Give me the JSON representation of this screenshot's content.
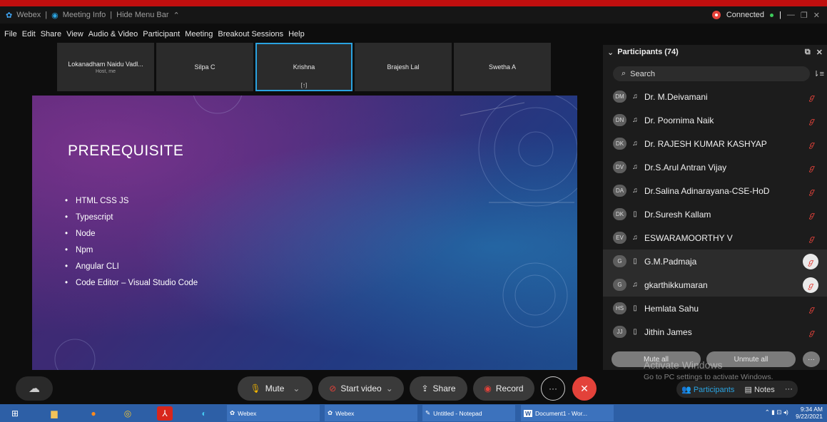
{
  "titlebar": {
    "app": "Webex",
    "info": "Meeting Info",
    "hide": "Hide Menu Bar",
    "status": "Connected"
  },
  "menu": [
    "File",
    "Edit",
    "Share",
    "View",
    "Audio & Video",
    "Participant",
    "Meeting",
    "Breakout Sessions",
    "Help"
  ],
  "thumbnails": [
    {
      "name": "Lokanadham Naidu Vadl...",
      "sub": "Host, me"
    },
    {
      "name": "Silpa C"
    },
    {
      "name": "Krishna",
      "sub": "[↑]"
    },
    {
      "name": "Brajesh Lal"
    },
    {
      "name": "Swetha A"
    }
  ],
  "slide": {
    "title": "PREREQUISITE",
    "bullets": [
      "HTML CSS JS",
      "Typescript",
      "Node",
      "Npm",
      "Angular CLI",
      "Code Editor – Visual Studio Code"
    ]
  },
  "participants": {
    "header": "Participants (74)",
    "search_placeholder": "Search",
    "items": [
      {
        "initials": "DM",
        "name": "Dr. M.Deivamani"
      },
      {
        "initials": "DN",
        "name": "Dr. Poornima Naik"
      },
      {
        "initials": "DK",
        "name": "Dr. RAJESH KUMAR KASHYAP"
      },
      {
        "initials": "DV",
        "name": "Dr.S.Arul Antran Vijay"
      },
      {
        "initials": "DA",
        "name": "Dr.Salina Adinarayana-CSE-HoD"
      },
      {
        "initials": "DK",
        "name": "Dr.Suresh Kallam"
      },
      {
        "initials": "EV",
        "name": "ESWARAMOORTHY V"
      },
      {
        "initials": "G",
        "name": "G.M.Padmaja"
      },
      {
        "initials": "G",
        "name": "gkarthikkumaran"
      },
      {
        "initials": "HS",
        "name": "Hemlata Sahu"
      },
      {
        "initials": "JJ",
        "name": "Jithin James"
      }
    ],
    "mute_all": "Mute all",
    "unmute_all": "Unmute all"
  },
  "watermark": {
    "line1": "Activate Windows",
    "line2": "Go to PC settings to activate Windows."
  },
  "controls": {
    "mute": "Mute",
    "start_video": "Start video",
    "share": "Share",
    "record": "Record",
    "participants": "Participants",
    "notes": "Notes"
  },
  "taskbar": {
    "webex1": "Webex",
    "webex2": "Webex",
    "notepad": "Untitled - Notepad",
    "word": "Document1 - Wor...",
    "time": "9:34 AM",
    "date": "9/22/2021"
  }
}
